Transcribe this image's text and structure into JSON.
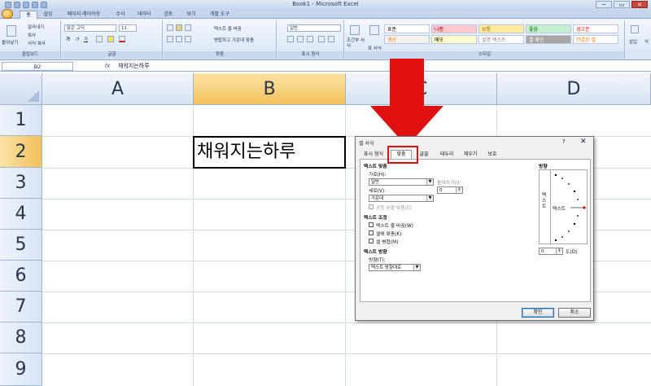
{
  "window": {
    "title": "Book1 - Microsoft Excel",
    "min": "─",
    "max": "▭",
    "close": "✕"
  },
  "tabs": [
    "홈",
    "삽입",
    "페이지 레이아웃",
    "수식",
    "데이터",
    "검토",
    "보기",
    "개발 도구"
  ],
  "ribbon": {
    "clipboard": {
      "paste": "붙여넣기",
      "cut": "잘라내기",
      "copy": "복사",
      "format_painter": "서식 복사",
      "label": "클립보드"
    },
    "font": {
      "name": "맑은 고딕",
      "size": "11",
      "label": "글꼴",
      "bold": "가",
      "italic": "가",
      "underline": "가"
    },
    "alignment": {
      "wrap": "텍스트 줄 바꿈",
      "merge": "병합하고 가운데 맞춤",
      "label": "맞춤"
    },
    "number": {
      "format": "일반",
      "label": "표시 형식"
    },
    "styles": {
      "conditional": "조건부 서식",
      "table": "표 서식",
      "label": "스타일",
      "cells": [
        {
          "text": "표준",
          "bg": "#ffffff",
          "color": "#000000"
        },
        {
          "text": "나쁨",
          "bg": "#ffc7ce",
          "color": "#9c0006"
        },
        {
          "text": "보통",
          "bg": "#ffeb9c",
          "color": "#9c6500"
        },
        {
          "text": "좋음",
          "bg": "#c6efce",
          "color": "#006100"
        },
        {
          "text": "경고문",
          "bg": "#ffffff",
          "color": "#ff0000"
        },
        {
          "text": "계산",
          "bg": "#f2f2f2",
          "color": "#fa7d00"
        },
        {
          "text": "메모",
          "bg": "#ffffcc",
          "color": "#000000"
        },
        {
          "text": "설명 텍스트",
          "bg": "#ffffff",
          "color": "#7f7f7f"
        },
        {
          "text": "셀 확인",
          "bg": "#a5a5a5",
          "color": "#ffffff"
        },
        {
          "text": "연결된 셀",
          "bg": "#ffffff",
          "color": "#fa7d00"
        }
      ]
    },
    "cells_group": {
      "insert": "삽입",
      "delete": "삭"
    }
  },
  "formula_bar": {
    "name_box": "B2",
    "fx": "fx",
    "content": "채워지는하루"
  },
  "sheet": {
    "columns": [
      "A",
      "B",
      "C",
      "D"
    ],
    "rows": [
      "1",
      "2",
      "3",
      "4",
      "5",
      "6",
      "7",
      "8",
      "9"
    ],
    "selected_col": "B",
    "selected_row": "2",
    "b2": "채워지는하루"
  },
  "dialog": {
    "title": "셀 서식",
    "help": "?",
    "close": "✕",
    "tabs": [
      "표시 형식",
      "맞춤",
      "글꼴",
      "테두리",
      "채우기",
      "보호"
    ],
    "active_tab": "맞춤",
    "text_align_heading": "텍스트 맞춤",
    "horizontal_label": "가로(H):",
    "horizontal_value": "일반",
    "indent_label": "들여쓰기(I):",
    "indent_value": "0",
    "vertical_label": "세로(V):",
    "vertical_value": "가운데",
    "justify_distributed": "균등 분할 맞춤(E)",
    "text_control_heading": "텍스트 조정",
    "wrap_text": "텍스트 줄 바꿈(W)",
    "shrink_fit": "셀에 맞춤(K)",
    "merge_cells": "셀 병합(M)",
    "text_direction_heading": "텍스트 방향",
    "direction_label": "방향(T):",
    "direction_value": "텍스트 방향대로",
    "orientation_heading": "방향",
    "orientation_vertical_text": "텍스트",
    "orientation_text": "텍스트",
    "degrees_value": "0",
    "degrees_label": "도(D)",
    "ok": "확인",
    "cancel": "취소"
  },
  "colors": {
    "accent_red": "#e01010",
    "header_selected": "#f3c05a"
  }
}
